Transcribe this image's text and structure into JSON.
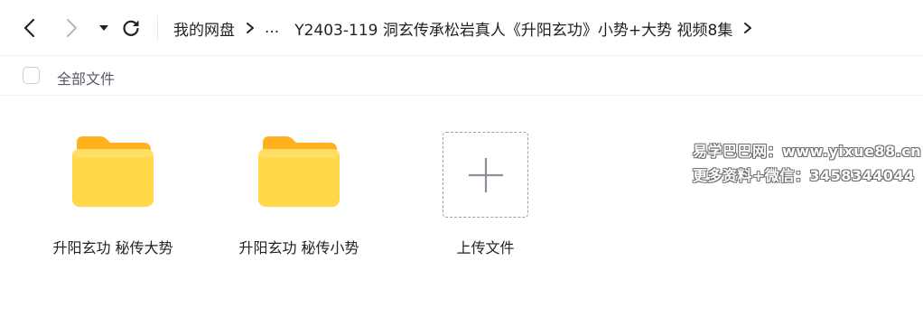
{
  "toolbar": {
    "back_icon": "chevron-left-icon",
    "forward_icon": "chevron-right-icon",
    "history_icon": "caret-down-icon",
    "refresh_icon": "refresh-icon"
  },
  "breadcrumb": {
    "root": "我的网盘",
    "ellipsis": "...",
    "current": "Y2403-119 洞玄传承松岩真人《升阳玄功》小势+大势 视频8集"
  },
  "select_all": {
    "label": "全部文件"
  },
  "files": [
    {
      "name": "升阳玄功 秘传大势",
      "type": "folder"
    },
    {
      "name": "升阳玄功 秘传小势",
      "type": "folder"
    }
  ],
  "upload": {
    "label": "上传文件",
    "icon": "plus-icon"
  },
  "watermark": {
    "line1": "易学巴巴网：www.yixue88.cn",
    "line2": "更多资料+微信：3458344044"
  },
  "colors": {
    "folder_front": "#ffd84a",
    "folder_back": "#ffb11f",
    "icon": "#222222",
    "disabled_icon": "#b8bcc2"
  }
}
